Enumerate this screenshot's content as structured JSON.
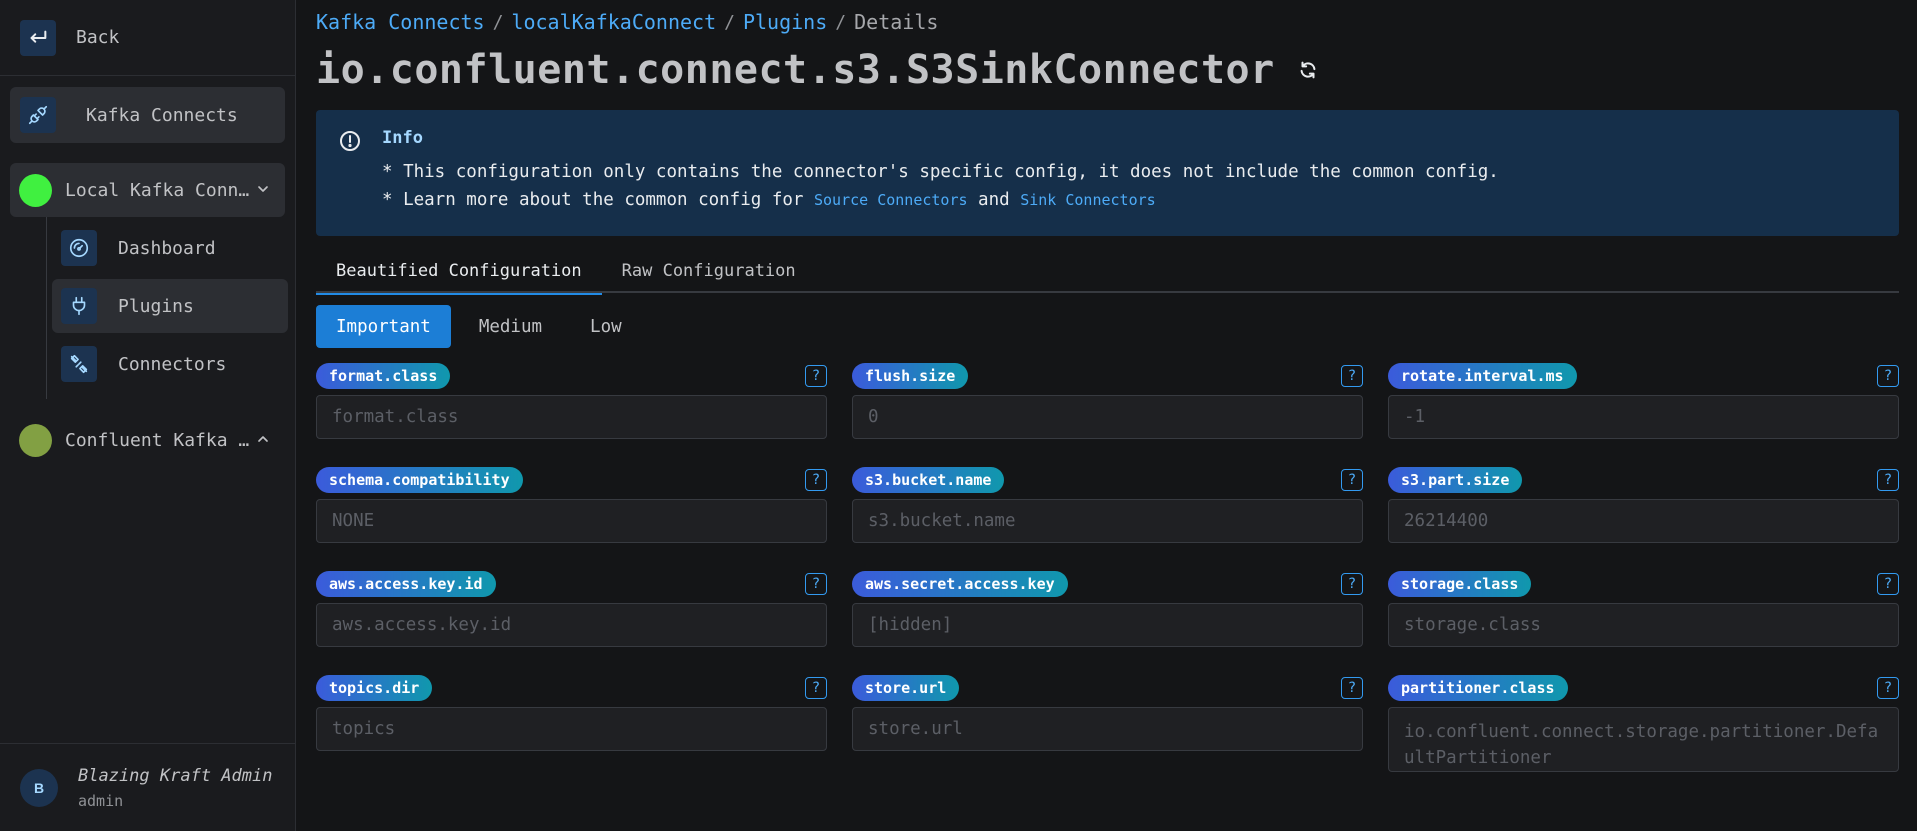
{
  "sidebar": {
    "back_label": "Back",
    "kafka_connects_label": "Kafka Connects",
    "clusters": [
      {
        "label": "Local Kafka Connect",
        "color": "#40f040",
        "expanded": true
      },
      {
        "label": "Confluent Kafka Connect",
        "color": "#82a043",
        "expanded": false
      }
    ],
    "subitems": [
      {
        "label": "Dashboard",
        "icon": "gauge-icon"
      },
      {
        "label": "Plugins",
        "icon": "plug-icon"
      },
      {
        "label": "Connectors",
        "icon": "plug-connected-icon"
      }
    ],
    "user": {
      "initial": "B",
      "name": "Blazing Kraft Admin",
      "role": "admin"
    }
  },
  "breadcrumb": {
    "items": [
      "Kafka Connects",
      "localKafkaConnect",
      "Plugins"
    ],
    "current": "Details"
  },
  "page_title": "io.confluent.connect.s3.S3SinkConnector",
  "info": {
    "title": "Info",
    "line1": "* This configuration only contains the connector's specific config, it does not include the common config.",
    "line2_prefix": "* Learn more about the common config for ",
    "link_source": "Source Connectors",
    "and_text": " and ",
    "link_sink": "Sink Connectors"
  },
  "tabs": [
    "Beautified Configuration",
    "Raw Configuration"
  ],
  "priority": [
    "Important",
    "Medium",
    "Low"
  ],
  "help_glyph": "?",
  "fields": [
    {
      "name": "format.class",
      "value": "format.class"
    },
    {
      "name": "flush.size",
      "value": "0"
    },
    {
      "name": "rotate.interval.ms",
      "value": "-1"
    },
    {
      "name": "schema.compatibility",
      "value": "NONE"
    },
    {
      "name": "s3.bucket.name",
      "value": "s3.bucket.name"
    },
    {
      "name": "s3.part.size",
      "value": "26214400"
    },
    {
      "name": "aws.access.key.id",
      "value": "aws.access.key.id"
    },
    {
      "name": "aws.secret.access.key",
      "value": "[hidden]"
    },
    {
      "name": "storage.class",
      "value": "storage.class"
    },
    {
      "name": "topics.dir",
      "value": "topics"
    },
    {
      "name": "store.url",
      "value": "store.url"
    },
    {
      "name": "partitioner.class",
      "value": "io.confluent.connect.storage.partitioner.DefaultPartitioner"
    }
  ]
}
